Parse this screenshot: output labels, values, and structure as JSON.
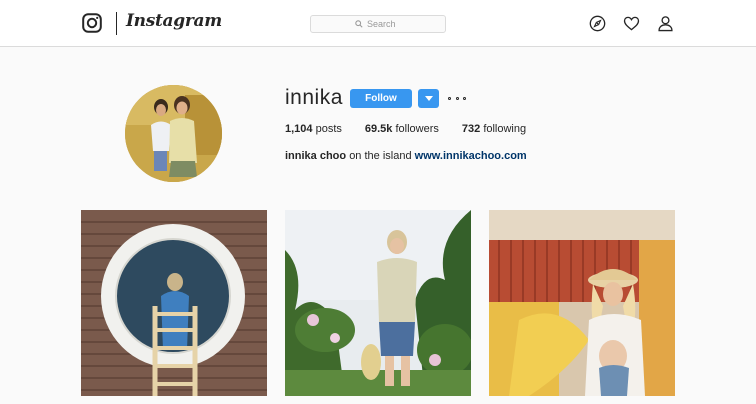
{
  "app": {
    "wordmark": "Instagram"
  },
  "search": {
    "placeholder": "Search"
  },
  "nav": {
    "icons": [
      "explore-icon",
      "heart-icon",
      "profile-icon"
    ]
  },
  "profile": {
    "username": "innika",
    "follow_label": "Follow",
    "stats": {
      "posts_count": "1,104",
      "posts_label": "posts",
      "followers_count": "69.5k",
      "followers_label": "followers",
      "following_count": "732",
      "following_label": "following"
    },
    "bio": {
      "full_name": "innika choo",
      "text": "on the island",
      "link": "www.innikachoo.com"
    }
  },
  "colors": {
    "accent": "#3897f0",
    "link": "#003569",
    "background": "#fafafa",
    "border": "#dbdbdb"
  }
}
